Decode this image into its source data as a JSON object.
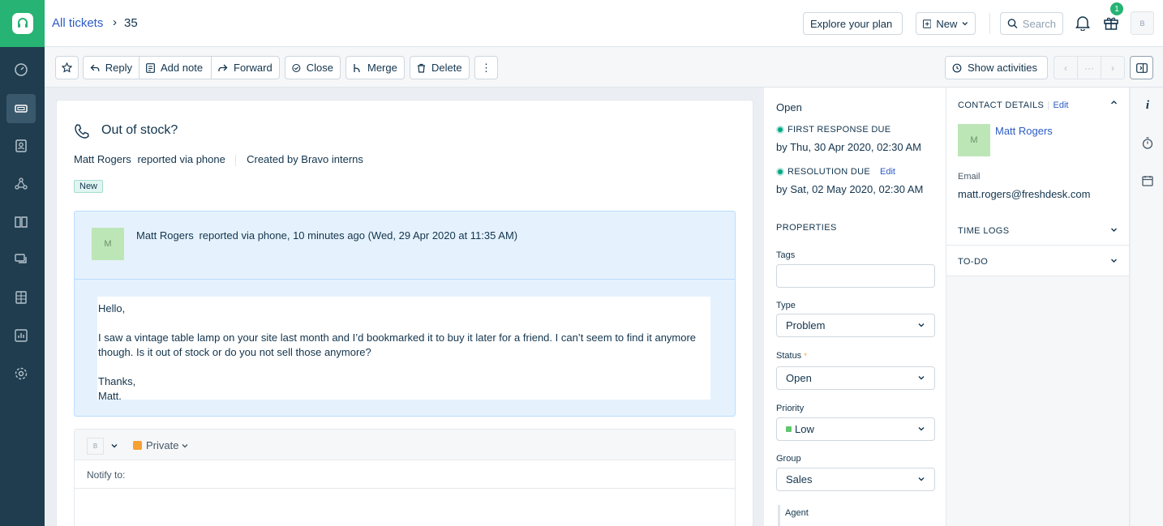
{
  "header": {
    "breadcrumb_root": "All tickets",
    "breadcrumb_sep": "›",
    "ticket_id": "35",
    "explore_label": "Explore your plan",
    "new_label": "New",
    "search_placeholder": "Search",
    "gift_count": "1",
    "user_initial": "B"
  },
  "toolbar": {
    "reply": "Reply",
    "add_note": "Add note",
    "forward": "Forward",
    "close": "Close",
    "merge": "Merge",
    "delete": "Delete",
    "more": "⋮",
    "show_activities": "Show activities",
    "pager_mid": "···"
  },
  "ticket": {
    "subject": "Out of stock?",
    "requester": "Matt Rogers",
    "via": "reported via phone",
    "created_by": "Created by Bravo interns",
    "status_badge": "New"
  },
  "conversation": {
    "avatar_initial": "M",
    "author": "Matt Rogers",
    "meta": "reported via phone, 10 minutes ago (Wed, 29 Apr 2020 at 11:35 AM)",
    "greeting": "Hello,",
    "body": "I saw a vintage table lamp on your site last month and I’d bookmarked it to buy it later for a friend. I can’t seem to find it anymore though. Is it out of stock or do you not sell those anymore?",
    "signoff": "Thanks,",
    "signature": "Matt."
  },
  "reply": {
    "agent_initial": "B",
    "visibility": "Private",
    "notify_label": "Notify to:"
  },
  "properties": {
    "status": "Open",
    "first_response_label": "FIRST RESPONSE DUE",
    "first_response_value": "by Thu, 30 Apr 2020, 02:30 AM",
    "resolution_label": "RESOLUTION DUE",
    "resolution_edit": "Edit",
    "resolution_value": "by Sat, 02 May 2020, 02:30 AM",
    "section_title": "PROPERTIES",
    "tags_label": "Tags",
    "type_label": "Type",
    "type_value": "Problem",
    "status_label": "Status",
    "required_mark": "*",
    "status_value": "Open",
    "priority_label": "Priority",
    "priority_value": "Low",
    "group_label": "Group",
    "group_value": "Sales",
    "agent_label": "Agent"
  },
  "contact": {
    "title": "CONTACT DETAILS",
    "separator": "|",
    "edit": "Edit",
    "avatar_initial": "M",
    "name": "Matt Rogers",
    "email_label": "Email",
    "email": "matt.rogers@freshdesk.com",
    "time_logs": "TIME LOGS",
    "todo": "TO-DO"
  },
  "rail": {
    "info_glyph": "i"
  },
  "colors": {
    "brand_green": "#26b373",
    "nav_bg": "#1f3d4f",
    "link_blue": "#2c5cc5",
    "conversation_bg": "#e5f2fd",
    "priority_low": "#5fc76d"
  }
}
